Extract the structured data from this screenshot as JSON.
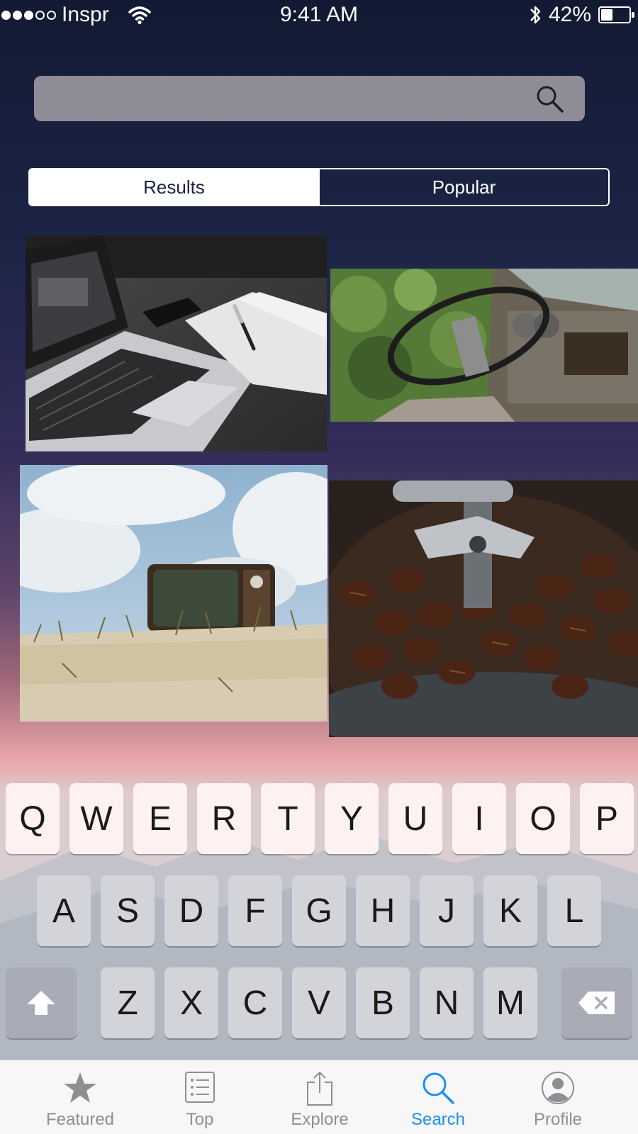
{
  "status_bar": {
    "carrier": "Inspr",
    "time": "9:41 AM",
    "battery": "42%",
    "battery_level": 0.42,
    "signal_bars_filled": 3,
    "signal_bars_total": 5
  },
  "search": {
    "value": "",
    "placeholder": "",
    "icon": "magnifier-icon"
  },
  "segments": {
    "results": "Results",
    "popular": "Popular",
    "selected": "Results"
  },
  "photos": [
    {
      "subject": "laptop-desk-photo"
    },
    {
      "subject": "old-car-steering-wheel-photo"
    },
    {
      "subject": "retro-tv-on-sand-photo"
    },
    {
      "subject": "coffee-beans-grinder-photo"
    }
  ],
  "keyboard": {
    "row1": [
      "Q",
      "W",
      "E",
      "R",
      "T",
      "Y",
      "U",
      "I",
      "O",
      "P"
    ],
    "row2": [
      "A",
      "S",
      "D",
      "F",
      "G",
      "H",
      "J",
      "K",
      "L"
    ],
    "row3": [
      "Z",
      "X",
      "C",
      "V",
      "B",
      "N",
      "M"
    ],
    "shift_icon": "shift-arrow-icon",
    "delete_icon": "backspace-icon"
  },
  "tabbar": {
    "featured": "Featured",
    "top": "Top",
    "explore": "Explore",
    "search": "Search",
    "profile": "Profile",
    "selected": "Search"
  },
  "colors": {
    "accent": "#1a8ff0",
    "tab_inactive": "#8e8e93",
    "search_field": "#8e8c96"
  }
}
